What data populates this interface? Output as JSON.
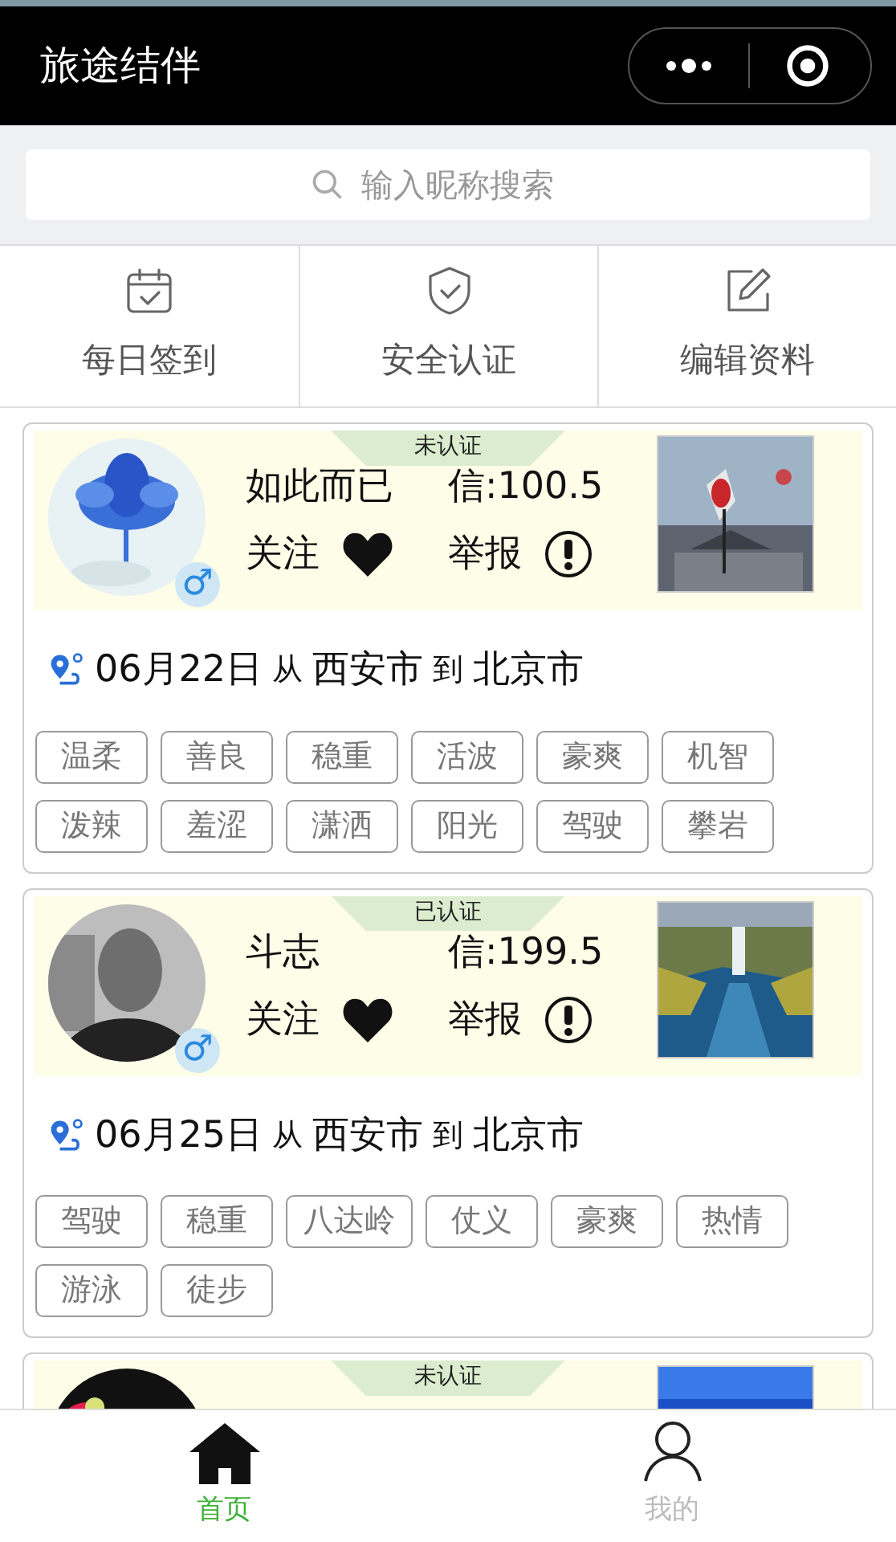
{
  "header": {
    "title": "旅途结伴"
  },
  "search": {
    "placeholder": "输入昵称搜索"
  },
  "actions": [
    {
      "label": "每日签到",
      "kind": "calendar"
    },
    {
      "label": "安全认证",
      "kind": "shield"
    },
    {
      "label": "编辑资料",
      "kind": "edit"
    }
  ],
  "cards": [
    {
      "verification": "未认证",
      "name": "如此而已",
      "credit": "信:100.5",
      "follow": "关注",
      "report": "举报",
      "gender": "♂",
      "date": "06月22日",
      "from_word": "从",
      "from": "西安市",
      "to_word": "到",
      "to": "北京市",
      "tags": [
        "温柔",
        "善良",
        "稳重",
        "活波",
        "豪爽",
        "机智",
        "泼辣",
        "羞涩",
        "潇洒",
        "阳光",
        "驾驶",
        "攀岩"
      ]
    },
    {
      "verification": "已认证",
      "name": "斗志",
      "credit": "信:199.5",
      "follow": "关注",
      "report": "举报",
      "gender": "♂",
      "date": "06月25日",
      "from_word": "从",
      "from": "西安市",
      "to_word": "到",
      "to": "北京市",
      "tags": [
        "驾驶",
        "稳重",
        "八达岭",
        "仗义",
        "豪爽",
        "热情",
        "游泳",
        "徒步"
      ]
    },
    {
      "verification": "未认证"
    }
  ],
  "tabbar": [
    {
      "label": "首页",
      "kind": "home",
      "selected": true
    },
    {
      "label": "我的",
      "kind": "person",
      "selected": false
    }
  ]
}
